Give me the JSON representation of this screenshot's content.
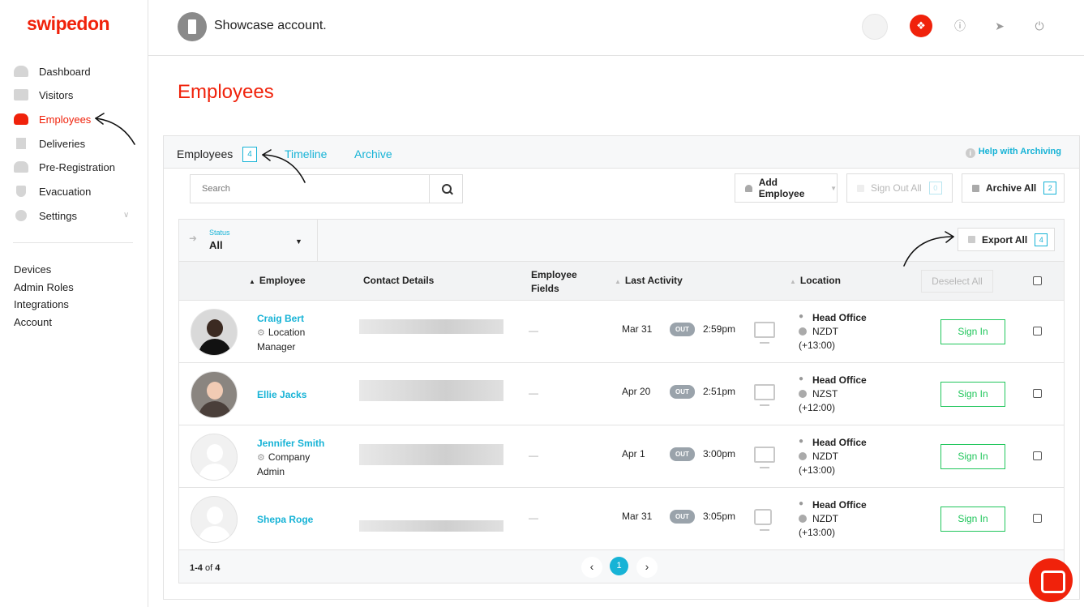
{
  "brand": "swipedon",
  "sidebar": {
    "items": [
      {
        "label": "Dashboard",
        "icon": "dashboard-icon"
      },
      {
        "label": "Visitors",
        "icon": "visitors-icon"
      },
      {
        "label": "Employees",
        "icon": "employees-icon"
      },
      {
        "label": "Deliveries",
        "icon": "deliveries-icon"
      },
      {
        "label": "Pre-Registration",
        "icon": "pre-registration-icon"
      },
      {
        "label": "Evacuation",
        "icon": "evacuation-icon"
      },
      {
        "label": "Settings",
        "icon": "settings-icon"
      }
    ],
    "secondary": [
      "Devices",
      "Admin Roles",
      "Integrations",
      "Account"
    ]
  },
  "header": {
    "account_name": "Showcase account."
  },
  "page": {
    "title": "Employees"
  },
  "tabs": {
    "employees": "Employees",
    "employees_count": "4",
    "timeline": "Timeline",
    "archive": "Archive",
    "help": "Help with Archiving"
  },
  "toolbar": {
    "search_placeholder": "Search",
    "add_employee": "Add Employee",
    "sign_out_all": "Sign Out All",
    "sign_out_count": "0",
    "archive_all": "Archive All",
    "archive_count": "2",
    "export_all": "Export All",
    "export_count": "4"
  },
  "filter": {
    "label": "Status",
    "value": "All"
  },
  "table": {
    "columns": {
      "employee": "Employee",
      "contact": "Contact Details",
      "fields_1": "Employee",
      "fields_2": "Fields",
      "activity": "Last Activity",
      "location": "Location",
      "deselect": "Deselect All"
    },
    "rows": [
      {
        "name": "Craig Bert",
        "role": "Location Manager",
        "fields": "—",
        "date": "Mar 31",
        "status": "OUT",
        "time": "2:59pm",
        "location": "Head Office",
        "tz": "NZDT",
        "offset": "(+13:00)",
        "action": "Sign In"
      },
      {
        "name": "Ellie Jacks",
        "role": "",
        "fields": "—",
        "date": "Apr 20",
        "status": "OUT",
        "time": "2:51pm",
        "location": "Head Office",
        "tz": "NZST",
        "offset": "(+12:00)",
        "action": "Sign In"
      },
      {
        "name": "Jennifer Smith",
        "role": "Company Admin",
        "fields": "—",
        "date": "Apr 1",
        "status": "OUT",
        "time": "3:00pm",
        "location": "Head Office",
        "tz": "NZDT",
        "offset": "(+13:00)",
        "action": "Sign In"
      },
      {
        "name": "Shepa Roge",
        "role": "",
        "fields": "—",
        "date": "Mar 31",
        "status": "OUT",
        "time": "3:05pm",
        "location": "Head Office",
        "tz": "NZDT",
        "offset": "(+13:00)",
        "action": "Sign In"
      }
    ]
  },
  "pager": {
    "range": "1-4",
    "of": "of",
    "total": "4",
    "current": "1"
  },
  "colors": {
    "brand": "#f0220b",
    "accent": "#17b3d6",
    "success": "#21c65c"
  }
}
